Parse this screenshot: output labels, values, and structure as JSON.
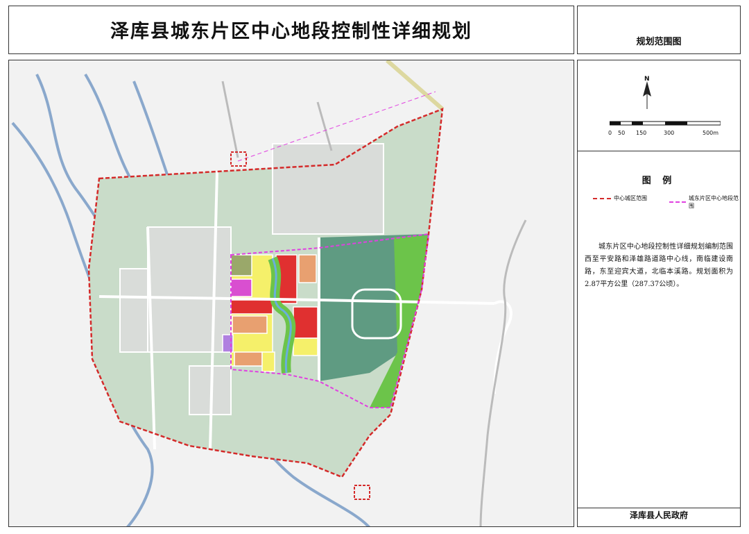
{
  "title": "泽库县城东片区中心地段控制性详细规划",
  "sheet_name": "规划范围图",
  "north_label": "N",
  "scale_labels": [
    "0",
    "50",
    "150",
    "300",
    "500m"
  ],
  "legend": {
    "title": "图 例",
    "items": [
      {
        "label": "中心城区范围",
        "color": "#d42a2a"
      },
      {
        "label": "城东片区中心地段范围",
        "color": "#e040e0"
      }
    ]
  },
  "description": "城东片区中心地段控制性详细规划编制范围西至平安路和泽雄路道路中心线，南临建设南路，东至迎宾大道，北临本溪路。规划面积为2.87平方公里（287.37公顷）。",
  "issuer": "泽库县人民政府",
  "colors": {
    "urban_boundary": "#d42a2a",
    "plan_boundary": "#e040e0",
    "green_land": "#c9dcc9",
    "dark_green": "#5f9b82",
    "bright_green": "#6cc44a",
    "residential": "#f5f06a",
    "commercial": "#e03030",
    "river": "#8aa8cc"
  }
}
